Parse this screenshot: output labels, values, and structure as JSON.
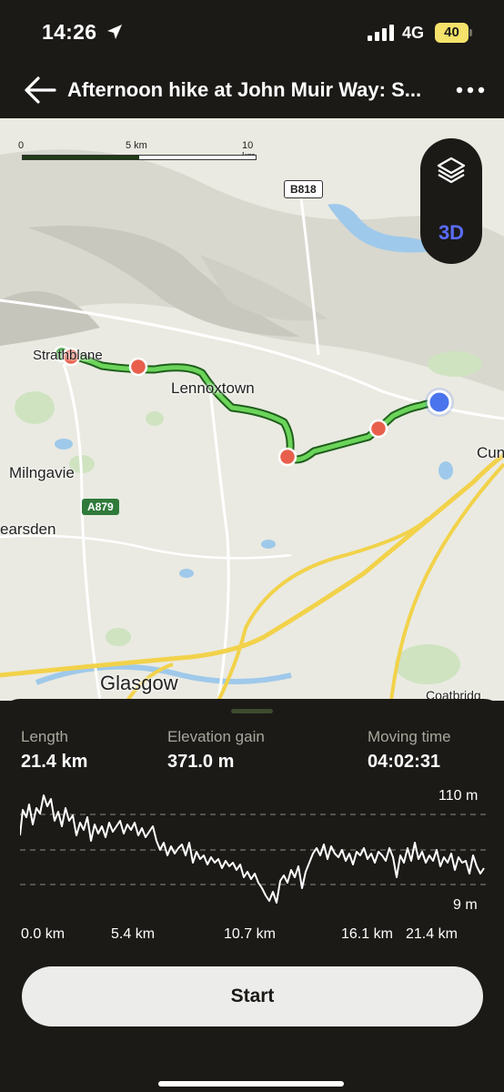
{
  "status_bar": {
    "time": "14:26",
    "network": "4G",
    "battery": "40",
    "location_icon": "location-arrow-icon",
    "signal_icon": "cellular-signal-icon"
  },
  "header": {
    "title": "Afternoon hike at John Muir Way: S...",
    "back_icon": "arrow-left-icon",
    "more_icon": "more-horizontal-icon"
  },
  "map": {
    "scale": {
      "ticks": [
        "0",
        "5 km",
        "10 km"
      ]
    },
    "labels": {
      "strathblane": "Strathblane",
      "lennoxtown": "Lennoxtown",
      "milngavie": "Milngavie",
      "bearsden": "earsden",
      "glasgow": "Glasgow",
      "cumbernauld": "Cun",
      "coatbridge": "Coatbridg"
    },
    "roads": {
      "b818": "B818",
      "a879": "A879"
    },
    "controls": {
      "layers_icon": "layers-icon",
      "button_3d": "3D"
    },
    "colors": {
      "route": "#2f9a2d",
      "waypoint": "#e8604c",
      "current_location": "#4a74ee",
      "water": "#9fc9ea",
      "road": "#f2d24a"
    }
  },
  "stats": {
    "length": {
      "label": "Length",
      "value": "21.4 km"
    },
    "elevation_gain": {
      "label": "Elevation gain",
      "value": "371.0 m"
    },
    "moving_time": {
      "label": "Moving time",
      "value": "04:02:31"
    }
  },
  "elevation_profile": {
    "max_label": "110 m",
    "min_label": "9 m",
    "distance_labels": [
      "0.0 km",
      "5.4 km",
      "10.7 km",
      "16.1 km",
      "21.4 km"
    ]
  },
  "start_button": {
    "label": "Start"
  }
}
